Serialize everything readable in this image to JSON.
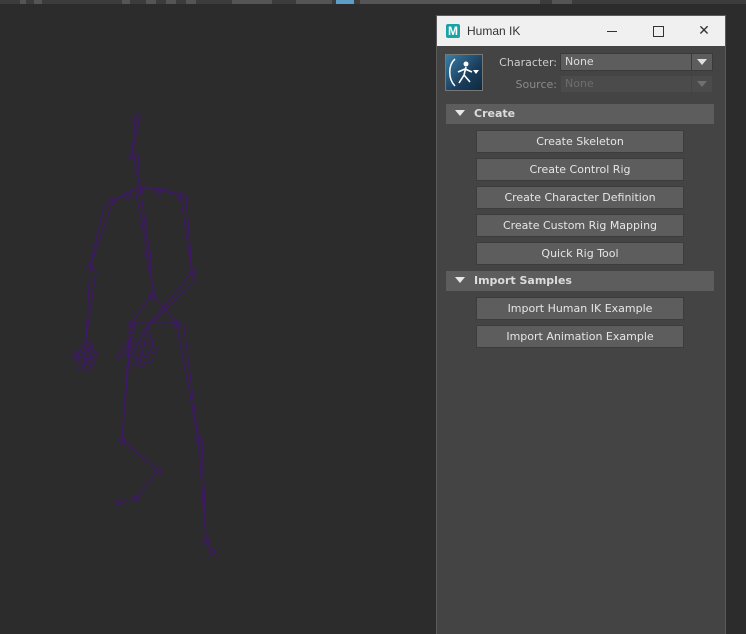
{
  "window": {
    "title": "Human IK",
    "app_icon_letter": "M",
    "minimize_label": "",
    "maximize_label": "",
    "close_label": "✕"
  },
  "character": {
    "label": "Character:",
    "value": "None",
    "icon": "character-silhouette-icon"
  },
  "source": {
    "label": "Source:",
    "value": "None",
    "disabled": true
  },
  "sections": {
    "create": {
      "title": "Create",
      "buttons": [
        "Create Skeleton",
        "Create Control Rig",
        "Create Character Definition",
        "Create Custom Rig Mapping",
        "Quick Rig Tool"
      ]
    },
    "import_samples": {
      "title": "Import Samples",
      "buttons": [
        "Import Human IK Example",
        "Import Animation Example"
      ]
    }
  },
  "colors": {
    "viewport_bg": "#2c2c2c",
    "panel_bg": "#444444",
    "skeleton_wire": "#3d1a63",
    "button_bg": "#5d5d5d"
  }
}
